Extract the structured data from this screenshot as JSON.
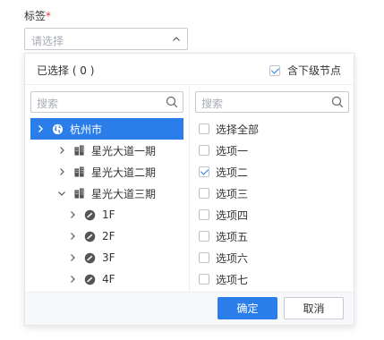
{
  "field": {
    "label": "标签",
    "required_mark": "*",
    "placeholder": "请选择"
  },
  "panel": {
    "selected_count_label": "已选择 ( 0 )",
    "include_sub_label": "含下级节点",
    "include_sub_checked": true
  },
  "left": {
    "search_placeholder": "搜索",
    "tree": [
      {
        "label": "杭州市",
        "icon": "globe-icon",
        "expanded": false,
        "active": true,
        "level": 0
      },
      {
        "label": "星光大道一期",
        "icon": "building-icon",
        "expanded": false,
        "active": false,
        "level": 1
      },
      {
        "label": "星光大道二期",
        "icon": "building-icon",
        "expanded": false,
        "active": false,
        "level": 1
      },
      {
        "label": "星光大道三期",
        "icon": "building-icon",
        "expanded": true,
        "active": false,
        "level": 1
      },
      {
        "label": "1F",
        "icon": "floor-gauge-icon",
        "expanded": false,
        "active": false,
        "level": 2
      },
      {
        "label": "2F",
        "icon": "floor-gauge-icon",
        "expanded": false,
        "active": false,
        "level": 2
      },
      {
        "label": "3F",
        "icon": "floor-gauge-icon",
        "expanded": false,
        "active": false,
        "level": 2
      },
      {
        "label": "4F",
        "icon": "floor-gauge-icon",
        "expanded": false,
        "active": false,
        "level": 2
      }
    ]
  },
  "right": {
    "search_placeholder": "搜索",
    "options": [
      {
        "label": "选择全部",
        "checked": false
      },
      {
        "label": "选项一",
        "checked": false
      },
      {
        "label": "选项二",
        "checked": true
      },
      {
        "label": "选项三",
        "checked": false
      },
      {
        "label": "选项四",
        "checked": false
      },
      {
        "label": "选项五",
        "checked": false
      },
      {
        "label": "选项六",
        "checked": false
      },
      {
        "label": "选项七",
        "checked": false
      }
    ]
  },
  "footer": {
    "confirm_label": "确定",
    "cancel_label": "取消"
  },
  "colors": {
    "accent": "#2b7de9",
    "required": "#e53935",
    "placeholder": "#a8adb5"
  }
}
